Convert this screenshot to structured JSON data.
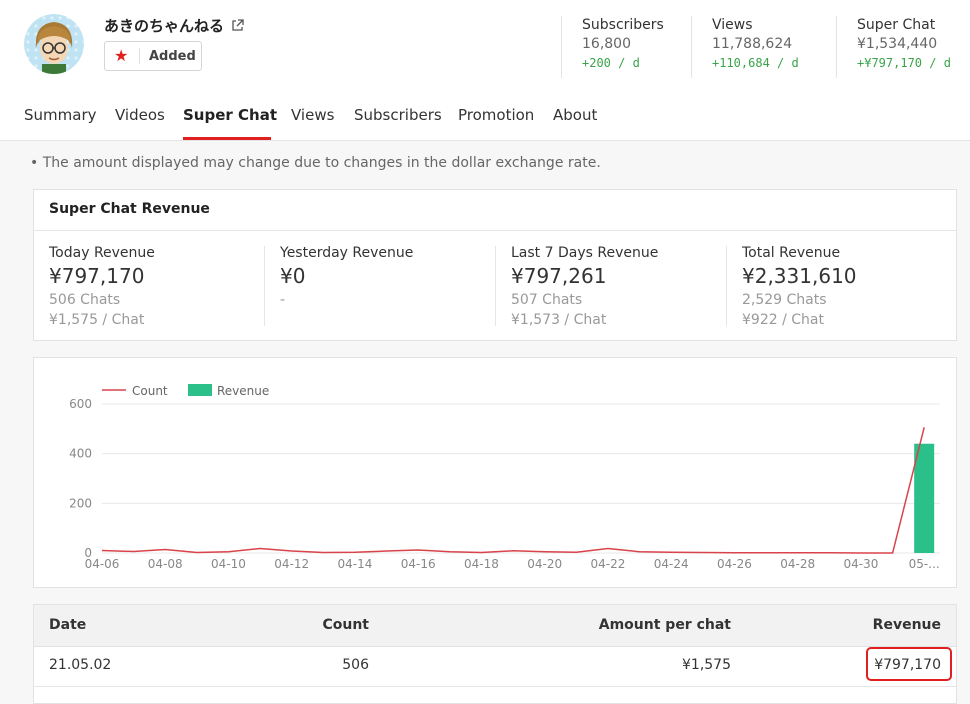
{
  "channel": {
    "name": "あきのちゃんねる",
    "added_label": "Added"
  },
  "stats": [
    {
      "title": "Subscribers",
      "value": "16,800",
      "delta": "+200 / d"
    },
    {
      "title": "Views",
      "value": "11,788,624",
      "delta": "+110,684 / d"
    },
    {
      "title": "Super Chat",
      "value": "¥1,534,440",
      "delta": "+¥797,170 / d"
    }
  ],
  "tabs": [
    "Summary",
    "Videos",
    "Super Chat",
    "Views",
    "Subscribers",
    "Promotion",
    "About"
  ],
  "active_tab": "Super Chat",
  "note": "• The amount displayed may change due to changes in the dollar exchange rate.",
  "revenue_card": {
    "title": "Super Chat Revenue",
    "items": [
      {
        "title": "Today Revenue",
        "value": "¥797,170",
        "chats": "506 Chats",
        "per_chat": "¥1,575 / Chat"
      },
      {
        "title": "Yesterday Revenue",
        "value": "¥0",
        "chats": "-",
        "per_chat": ""
      },
      {
        "title": "Last 7 Days Revenue",
        "value": "¥797,261",
        "chats": "507 Chats",
        "per_chat": "¥1,573 / Chat"
      },
      {
        "title": "Total Revenue",
        "value": "¥2,331,610",
        "chats": "2,529 Chats",
        "per_chat": "¥922 / Chat"
      }
    ]
  },
  "chart_data": {
    "type": "bar",
    "legend": [
      {
        "name": "Count",
        "kind": "line",
        "color": "#d9434a"
      },
      {
        "name": "Revenue",
        "kind": "bar",
        "color": "#2bbf8a"
      }
    ],
    "legend_position": "top-left",
    "ylim": [
      0,
      600
    ],
    "yticks": [
      "600",
      "400",
      "200",
      "0"
    ],
    "xtick_labels": [
      "04-06",
      "04-08",
      "04-10",
      "04-12",
      "04-14",
      "04-16",
      "04-18",
      "04-20",
      "04-22",
      "04-24",
      "04-26",
      "04-28",
      "04-30",
      "05-..."
    ],
    "x": [
      "04-06",
      "04-07",
      "04-08",
      "04-09",
      "04-10",
      "04-11",
      "04-12",
      "04-13",
      "04-14",
      "04-15",
      "04-16",
      "04-17",
      "04-18",
      "04-19",
      "04-20",
      "04-21",
      "04-22",
      "04-23",
      "04-24",
      "04-25",
      "04-26",
      "04-27",
      "04-28",
      "04-29",
      "04-30",
      "05-01",
      "05-02"
    ],
    "series": [
      {
        "name": "Count",
        "type": "line",
        "values": [
          10,
          6,
          14,
          2,
          5,
          18,
          8,
          2,
          3,
          8,
          12,
          5,
          2,
          9,
          5,
          3,
          18,
          5,
          3,
          2,
          1,
          1,
          1,
          1,
          0,
          0,
          506
        ]
      },
      {
        "name": "Revenue",
        "type": "bar",
        "values": [
          0,
          0,
          0,
          0,
          0,
          0,
          0,
          0,
          0,
          0,
          0,
          0,
          0,
          0,
          0,
          0,
          0,
          0,
          0,
          0,
          0,
          0,
          0,
          0,
          0,
          0,
          440
        ]
      }
    ],
    "grid": true
  },
  "table": {
    "headers": [
      "Date",
      "Count",
      "Amount per chat",
      "Revenue"
    ],
    "rows": [
      {
        "date": "21.05.02",
        "count": "506",
        "amount": "¥1,575",
        "revenue": "¥797,170"
      }
    ]
  }
}
